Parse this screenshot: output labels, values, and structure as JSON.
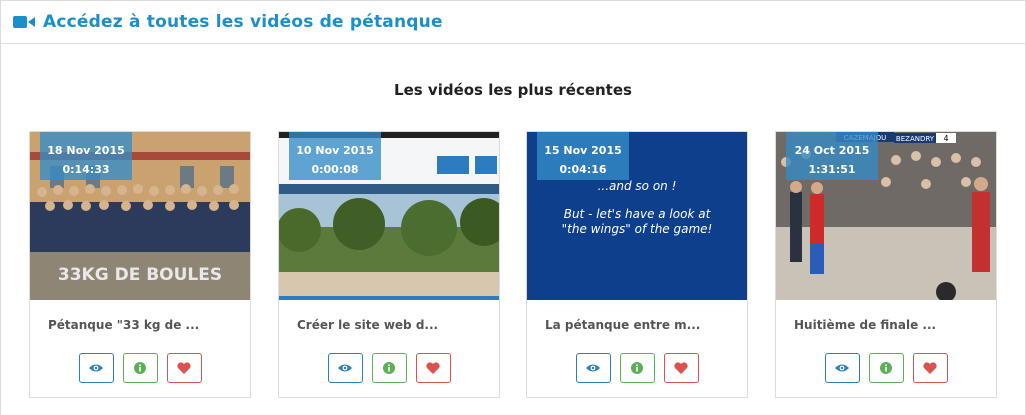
{
  "header": {
    "title": "Accédez à toutes les vidéos de pétanque",
    "icon": "video-camera-icon",
    "color": "#1a8fc9"
  },
  "section": {
    "title": "Les vidéos les plus récentes"
  },
  "videos": [
    {
      "date": "18 Nov 2015",
      "duration": "0:14:33",
      "title": "Pétanque \"33 kg de ...",
      "overlay_text": "33KG DE BOULES"
    },
    {
      "date": "10 Nov 2015",
      "duration": "0:00:08",
      "title": "Créer le site web d..."
    },
    {
      "date": "15 Nov 2015",
      "duration": "0:04:16",
      "title": "La pétanque entre m...",
      "overlay_lines": [
        "...and so on !",
        "But - let's have a look at",
        "\"the wings\" of the game!"
      ]
    },
    {
      "date": "24 Oct 2015",
      "duration": "1:31:51",
      "title": "Huitième de finale ...",
      "scoreboard": [
        "CAZEMAJOU",
        "BEZANDRY",
        "4"
      ]
    }
  ],
  "actions": [
    "eye-icon",
    "info-icon",
    "heart-icon"
  ],
  "colors": {
    "view": "#2a7fc0",
    "info": "#5cae58",
    "fav": "#d9534f",
    "badge": "#348cc8"
  }
}
